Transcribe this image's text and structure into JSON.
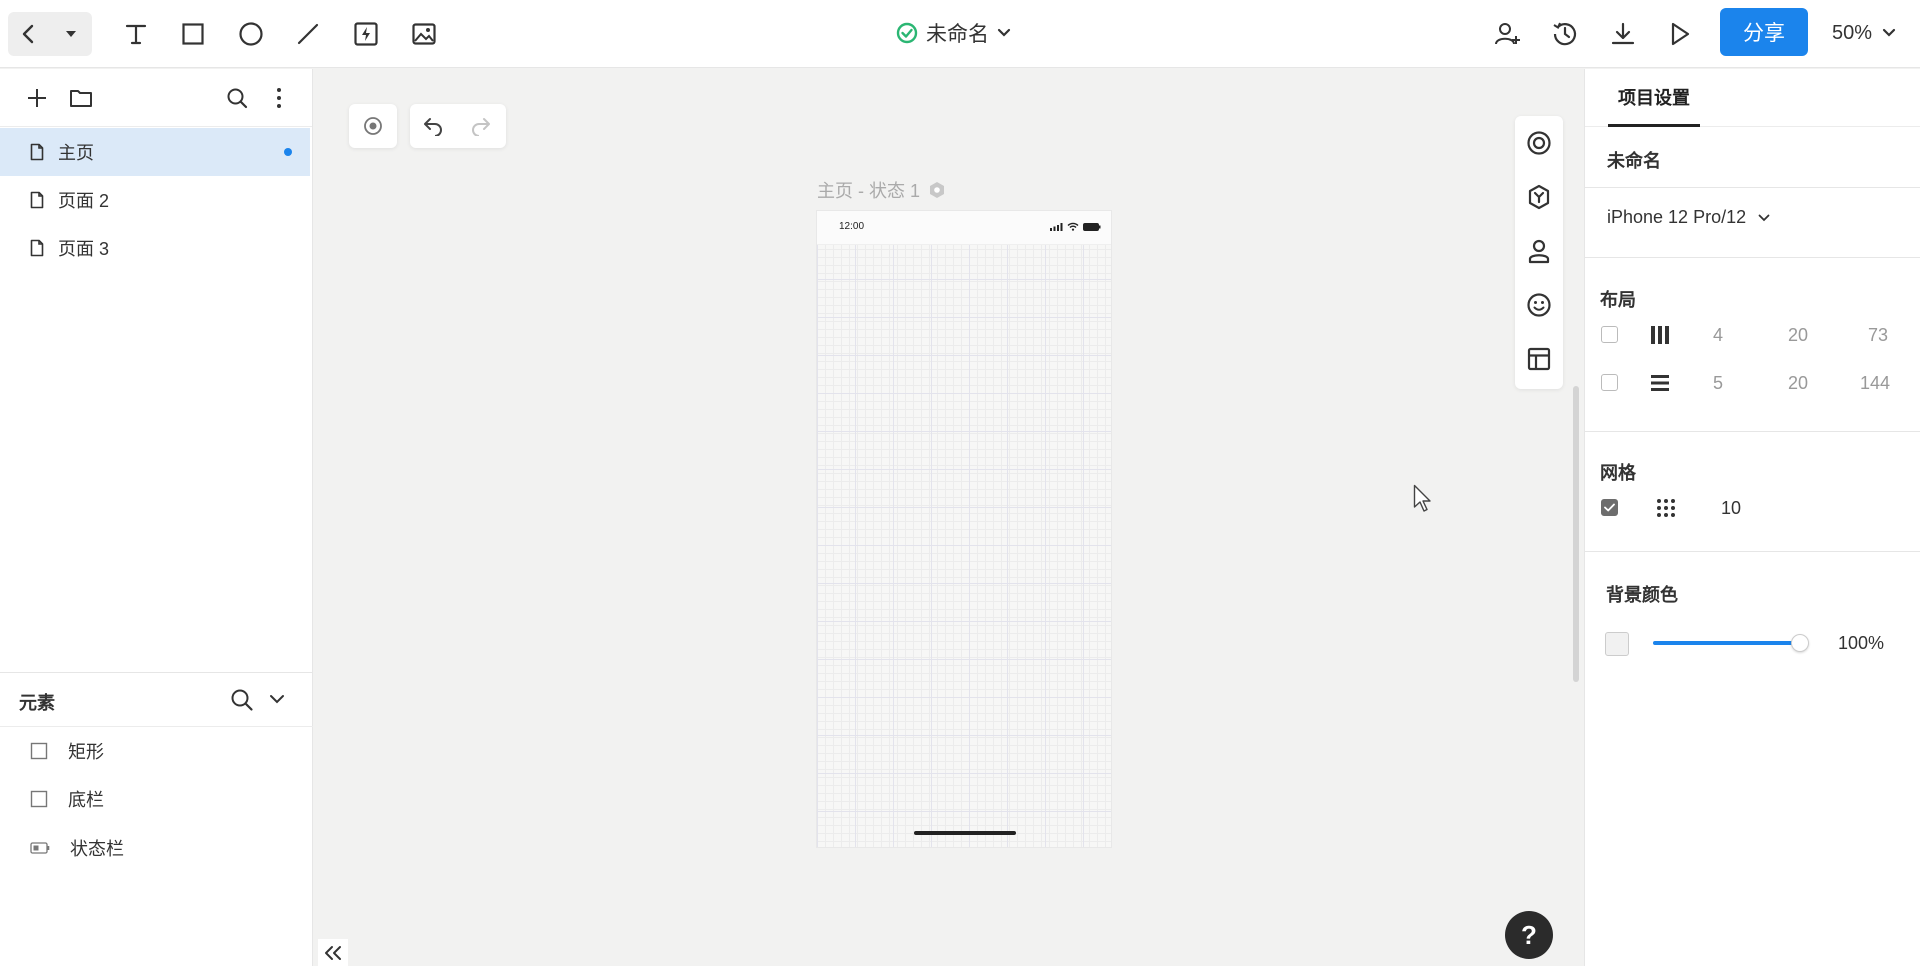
{
  "toolbar": {
    "doc_title": "未命名",
    "share_label": "分享",
    "zoom_label": "50%"
  },
  "pages": {
    "items": [
      {
        "label": "主页"
      },
      {
        "label": "页面 2"
      },
      {
        "label": "页面 3"
      }
    ]
  },
  "elements": {
    "title": "元素",
    "items": [
      {
        "label": "矩形"
      },
      {
        "label": "底栏"
      },
      {
        "label": "状态栏"
      }
    ]
  },
  "canvas": {
    "frame_label": "主页 - 状态 1",
    "status_time": "12:00"
  },
  "panel": {
    "tab_label": "项目设置",
    "project_name": "未命名",
    "device": "iPhone 12 Pro/12",
    "layout_title": "布局",
    "layout_columns": {
      "count": "4",
      "gutter": "20",
      "width": "73"
    },
    "layout_rows": {
      "count": "5",
      "gutter": "20",
      "height": "144"
    },
    "grid_title": "网格",
    "grid_size": "10",
    "grid_checked": true,
    "bg_title": "背景颜色",
    "bg_opacity": "100%",
    "bg_opacity_value": 1.0
  },
  "colors": {
    "accent": "#1b84ec",
    "status_ok": "#2bb673",
    "selected_page_bg": "#dbe9f8"
  }
}
